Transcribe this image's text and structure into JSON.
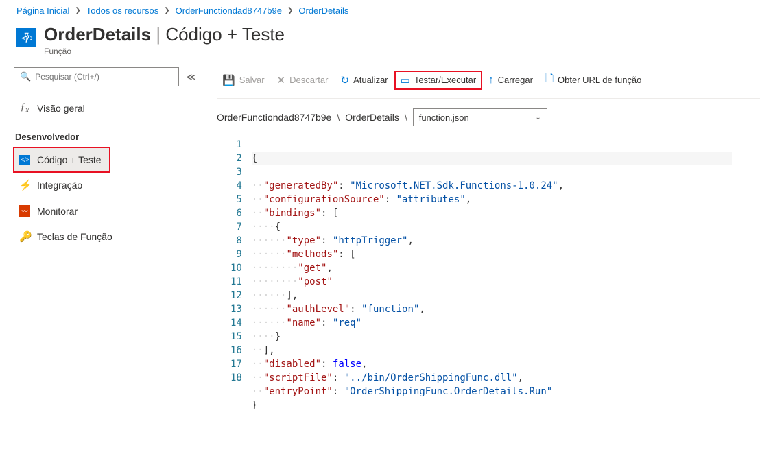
{
  "breadcrumb": {
    "home": "Página Inicial",
    "all": "Todos os recursos",
    "app": "OrderFunctiondad8747b9e",
    "fn": "OrderDetails"
  },
  "header": {
    "title_main": "OrderDetails",
    "title_sub": "Código + Teste",
    "subtitle": "Função"
  },
  "search": {
    "placeholder": "Pesquisar (Ctrl+/)"
  },
  "nav": {
    "overview": "Visão geral",
    "section": "Desenvolvedor",
    "code": "Código + Teste",
    "integration": "Integração",
    "monitor": "Monitorar",
    "keys": "Teclas de Função"
  },
  "toolbar": {
    "save": "Salvar",
    "discard": "Descartar",
    "refresh": "Atualizar",
    "test": "Testar/Executar",
    "upload": "Carregar",
    "getUrl": "Obter URL de função"
  },
  "path": {
    "p1": "OrderFunctiondad8747b9e",
    "p2": "OrderDetails",
    "file": "function.json"
  },
  "code": {
    "generatedBy_k": "\"generatedBy\"",
    "generatedBy_v": "\"Microsoft.NET.Sdk.Functions-1.0.24\"",
    "configurationSource_k": "\"configurationSource\"",
    "configurationSource_v": "\"attributes\"",
    "bindings_k": "\"bindings\"",
    "type_k": "\"type\"",
    "type_v": "\"httpTrigger\"",
    "methods_k": "\"methods\"",
    "get_v": "\"get\"",
    "post_v": "\"post\"",
    "authLevel_k": "\"authLevel\"",
    "authLevel_v": "\"function\"",
    "name_k": "\"name\"",
    "name_v": "\"req\"",
    "disabled_k": "\"disabled\"",
    "disabled_v": "false",
    "scriptFile_k": "\"scriptFile\"",
    "scriptFile_v": "\"../bin/OrderShippingFunc.dll\"",
    "entryPoint_k": "\"entryPoint\"",
    "entryPoint_v": "\"OrderShippingFunc.OrderDetails.Run\""
  }
}
